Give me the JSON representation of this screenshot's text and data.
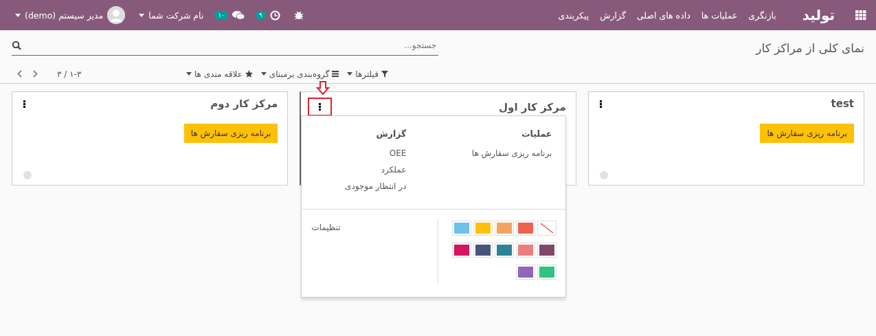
{
  "navbar": {
    "app_name": "تولید",
    "menu": [
      "بازنگری",
      "عملیات ها",
      "داده های اصلی",
      "گزارش",
      "پیکربندی"
    ],
    "activity_badge": "۹",
    "messages_badge": "۱۰",
    "company": "نام شرکت شما",
    "user": "مدیر سیستم (demo)"
  },
  "control_panel": {
    "title": "نمای کلی از مراکز کار",
    "search": {
      "placeholder": "جستجو..."
    },
    "filters": [
      {
        "kind": "filter",
        "label": "فیلترها"
      },
      {
        "kind": "group",
        "label": "گروه‌بندی برمبنای"
      },
      {
        "kind": "favorite",
        "label": "علاقه مندی ها"
      }
    ],
    "pager": "۱-۳ / ۳"
  },
  "cards": [
    {
      "title": "test",
      "button": "برنامه ریزی سفارش ها",
      "highlighted": false
    },
    {
      "title": "مرکز کار اول",
      "highlighted": true,
      "dropdown": {
        "columns": [
          {
            "heading": "عملیات",
            "items": [
              "برنامه ریزی سفارش ها"
            ]
          },
          {
            "heading": "گزارش",
            "items": [
              "OEE",
              "عملکرد",
              "در انتظار موجودی"
            ]
          }
        ],
        "colors": [
          {
            "kind": "none"
          },
          {
            "kind": "swatch",
            "color": "#f06050"
          },
          {
            "kind": "swatch",
            "color": "#f4a460"
          },
          {
            "kind": "swatch",
            "color": "#ffc107"
          },
          {
            "kind": "swatch",
            "color": "#6cc1ed"
          },
          {
            "kind": "swatch",
            "color": "#814968"
          },
          {
            "kind": "swatch",
            "color": "#eb7e7f"
          },
          {
            "kind": "swatch",
            "color": "#2c8397"
          },
          {
            "kind": "swatch",
            "color": "#475577"
          },
          {
            "kind": "swatch",
            "color": "#d6145f"
          },
          {
            "kind": "swatch",
            "color": "#30c381"
          },
          {
            "kind": "swatch",
            "color": "#9365b8"
          }
        ],
        "settings_link": "تنظیمات"
      }
    },
    {
      "title": "مرکز کار دوم",
      "button": "برنامه ریزی سفارش ها",
      "highlighted": false
    }
  ]
}
